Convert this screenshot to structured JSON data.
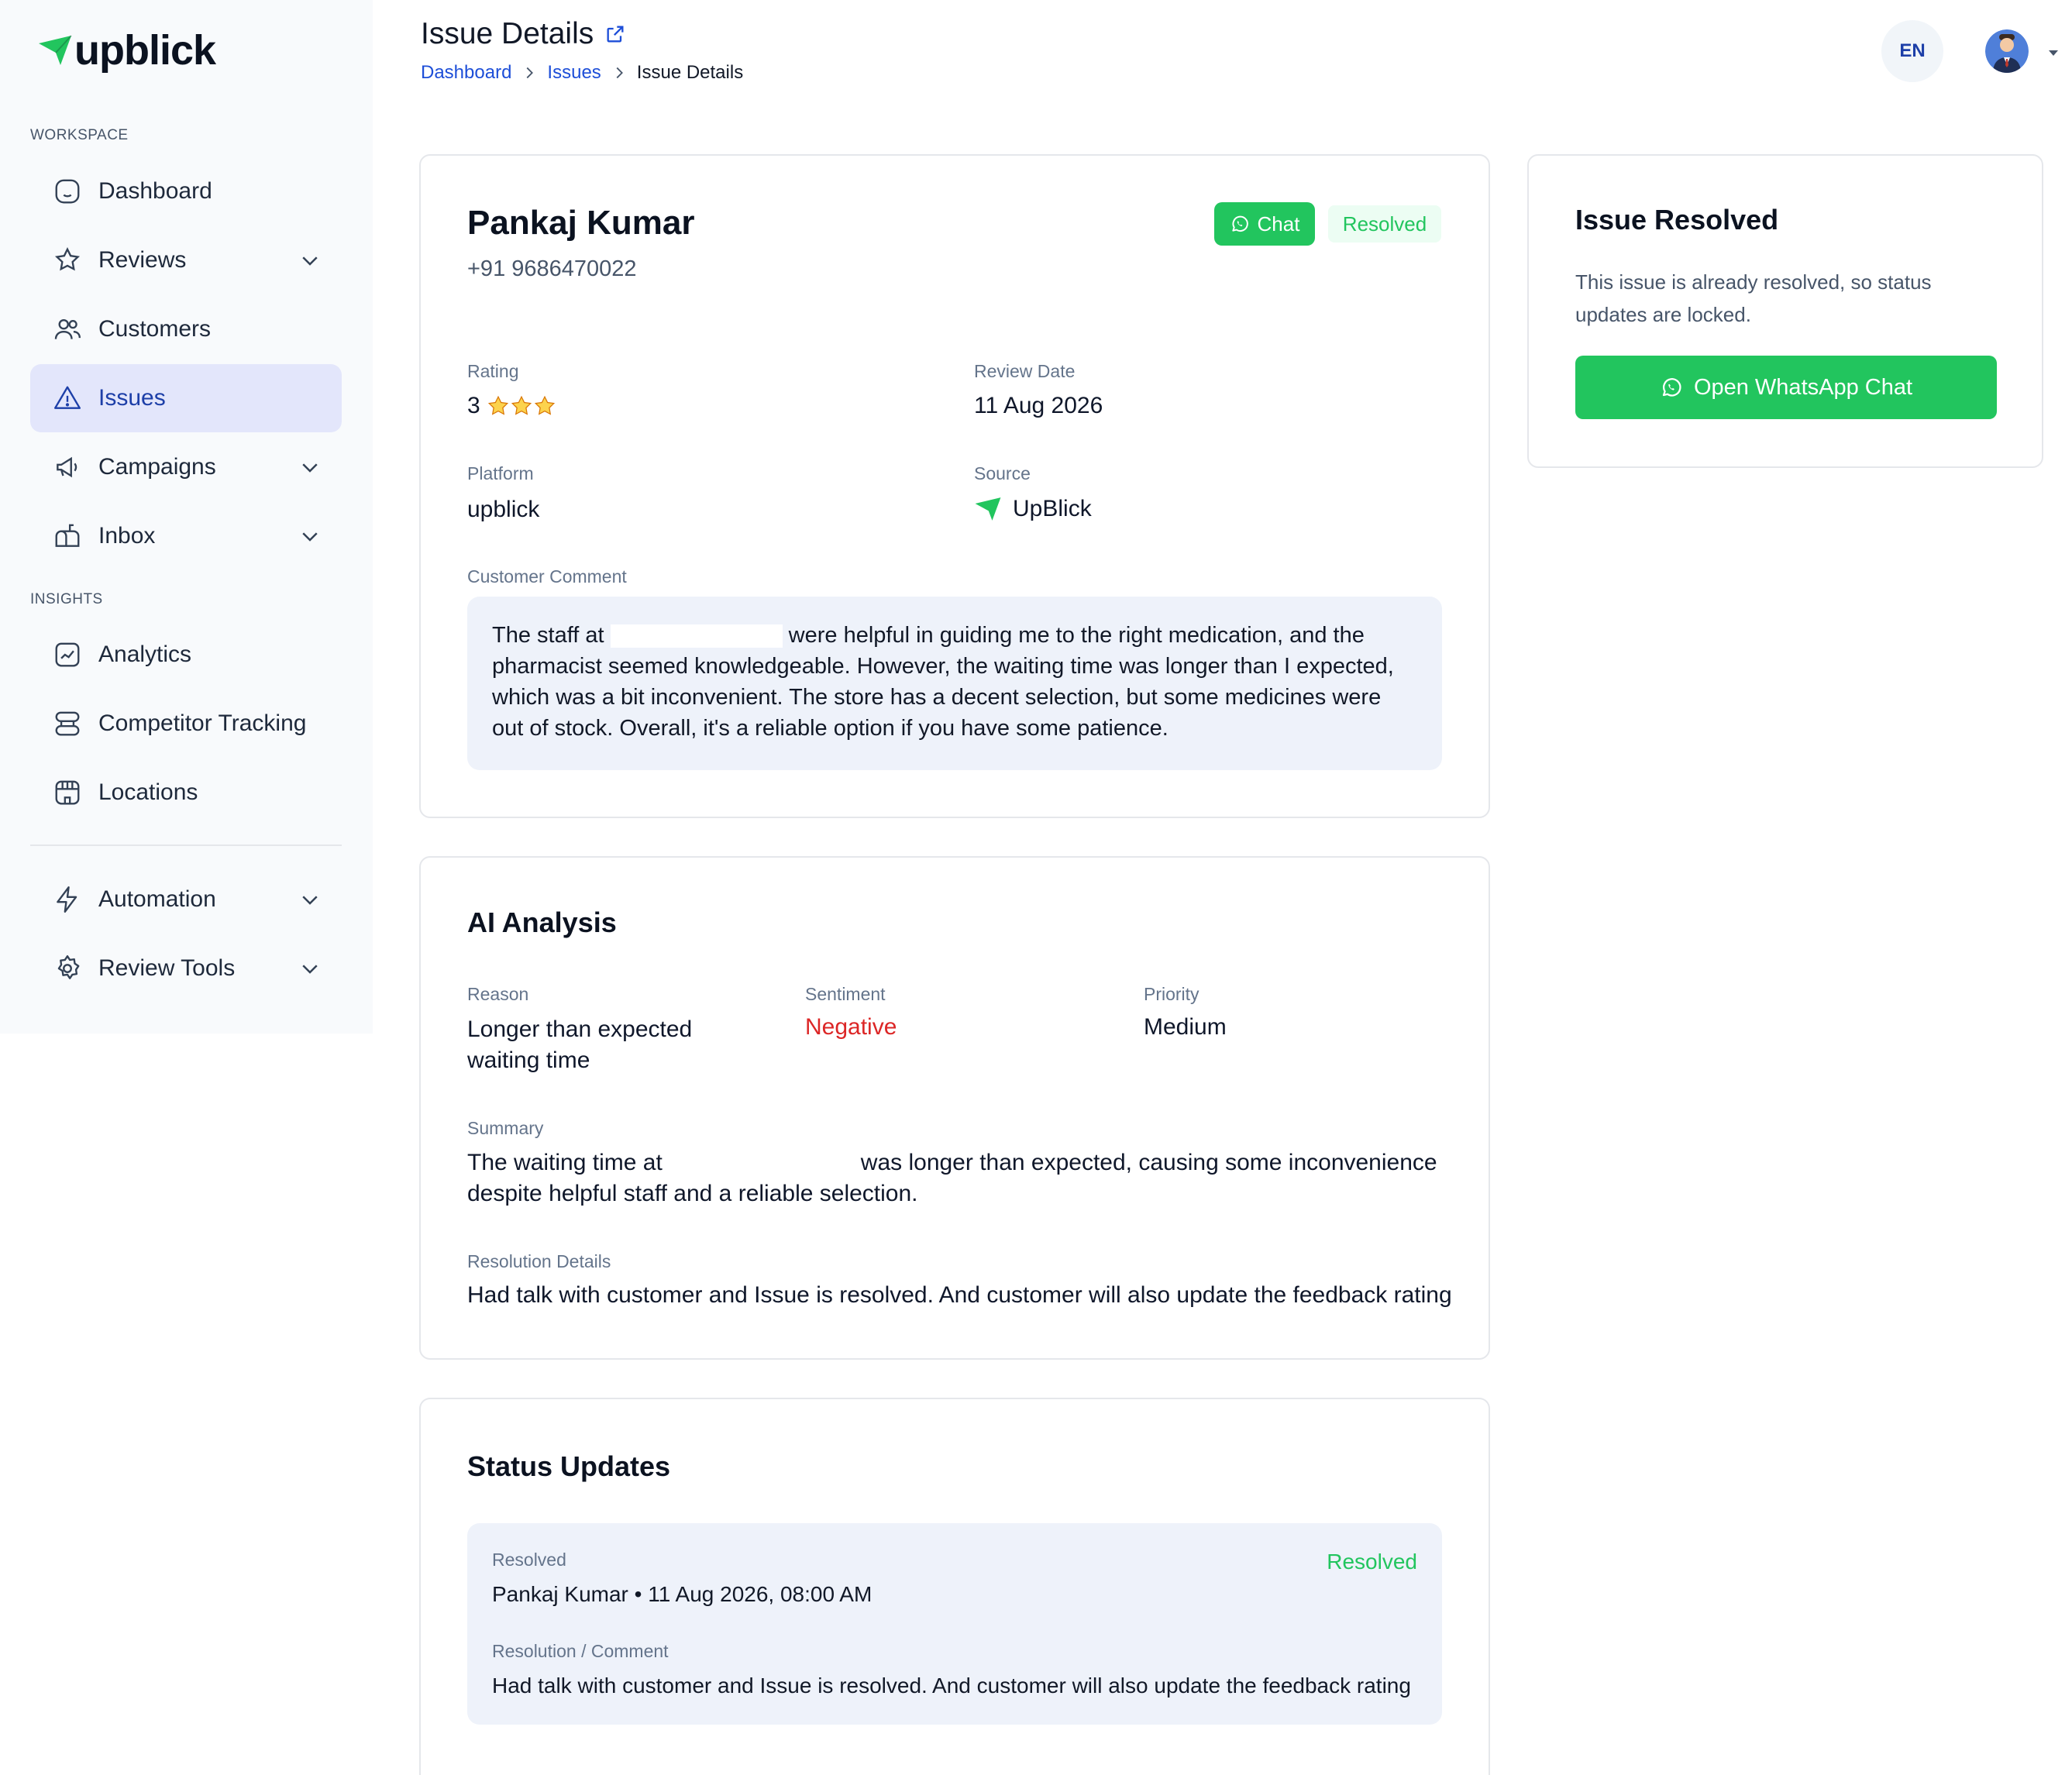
{
  "brand": {
    "name": "upblick",
    "accent": "#22c55e",
    "primary": "#1d3fa8"
  },
  "sidebar": {
    "workspace_label": "WORKSPACE",
    "insights_label": "INSIGHTS",
    "items": [
      {
        "label": "Dashboard",
        "icon": "dashboard-icon"
      },
      {
        "label": "Reviews",
        "icon": "reviews-icon"
      },
      {
        "label": "Customers",
        "icon": "customers-icon"
      },
      {
        "label": "Issues",
        "icon": "warning-icon"
      },
      {
        "label": "Campaigns",
        "icon": "megaphone-icon"
      },
      {
        "label": "Inbox",
        "icon": "mailbox-icon"
      },
      {
        "label": "Analytics",
        "icon": "analytics-icon"
      },
      {
        "label": "Competitor Tracking",
        "icon": "server-icon"
      },
      {
        "label": "Locations",
        "icon": "store-icon"
      },
      {
        "label": "Automation",
        "icon": "bolt-icon"
      },
      {
        "label": "Review Tools",
        "icon": "gear-icon"
      }
    ]
  },
  "header": {
    "title": "Issue Details",
    "breadcrumb": [
      "Dashboard",
      "Issues",
      "Issue Details"
    ],
    "language": "EN"
  },
  "issue": {
    "customer_name": "Pankaj Kumar",
    "phone": "+91 9686470022",
    "chat_label": "Chat",
    "status_badge": "Resolved",
    "rating_label": "Rating",
    "rating_value": "3",
    "review_date_label": "Review Date",
    "review_date": "11 Aug 2026",
    "platform_label": "Platform",
    "platform": "upblick",
    "source_label": "Source",
    "source": "UpBlick",
    "comment_label": "Customer Comment",
    "comment_before": "The staff at",
    "comment_after": " were helpful in guiding me to the right medication, and the pharmacist seemed knowledgeable. However, the waiting time was longer than I expected, which was a bit inconvenient. The store has a decent selection, but some medicines were out of stock. Overall, it's a reliable option if you have some patience."
  },
  "ai": {
    "title": "AI Analysis",
    "reason_label": "Reason",
    "reason": "Longer than expected waiting time",
    "sentiment_label": "Sentiment",
    "sentiment": "Negative",
    "priority_label": "Priority",
    "priority": "Medium",
    "summary_label": "Summary",
    "summary_before": "The waiting time at",
    "summary_after": "was longer than expected, causing some inconvenience despite helpful staff and a reliable selection.",
    "resolution_label": "Resolution Details",
    "resolution": "Had talk with customer and Issue is resolved. And customer will also update the feedback rating"
  },
  "status_updates": {
    "title": "Status Updates",
    "entry": {
      "status_label": "Resolved",
      "status": "Resolved",
      "meta": "Pankaj Kumar • 11 Aug 2026, 08:00 AM",
      "comment_label": "Resolution / Comment",
      "comment": "Had talk with customer and Issue is resolved. And customer will also update the feedback rating"
    }
  },
  "resolved_panel": {
    "title": "Issue Resolved",
    "description": "This issue is already resolved, so status updates are locked.",
    "button_label": "Open WhatsApp Chat"
  }
}
